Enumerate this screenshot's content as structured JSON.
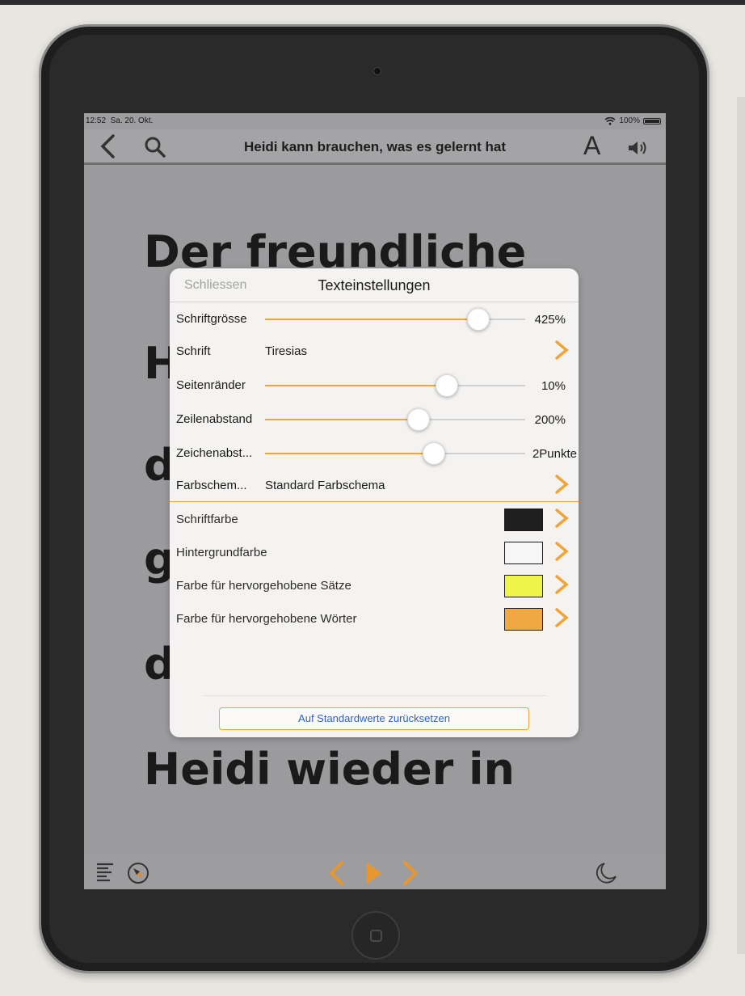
{
  "status_bar": {
    "time": "12:52",
    "date": "Sa. 20. Okt.",
    "battery": "100%"
  },
  "nav": {
    "back_icon": "chevron-left-icon",
    "search_icon": "search-icon",
    "title": "Heidi kann brauchen, was es gelernt hat",
    "font_label": "A",
    "speaker_icon": "speaker-icon"
  },
  "book": {
    "lines": [
      "Der freundliche",
      "H",
      "d",
      "g",
      "d",
      "Heidi wieder in"
    ]
  },
  "settings": {
    "close_label": "Schliessen",
    "title": "Texteinstellungen",
    "font_size": {
      "label": "Schriftgrösse",
      "value_text": "425%",
      "fraction": 0.82
    },
    "font": {
      "label": "Schrift",
      "value": "Tiresias"
    },
    "margins": {
      "label": "Seitenränder",
      "value_text": "10%",
      "fraction": 0.7
    },
    "line_spacing": {
      "label": "Zeilenabstand",
      "value_text": "200%",
      "fraction": 0.59
    },
    "char_spacing": {
      "label": "Zeichenabst...",
      "value_text": "2Punkte",
      "fraction": 0.65
    },
    "color_scheme": {
      "label": "Farbschem...",
      "value": "Standard Farbschema"
    },
    "colors": [
      {
        "label": "Schriftfarbe",
        "color": "#1f1f1f"
      },
      {
        "label": "Hintergrundfarbe",
        "color": "#f6f6f6"
      },
      {
        "label": "Farbe für hervorgehobene Sätze",
        "color": "#eef548"
      },
      {
        "label": "Farbe für hervorgehobene Wörter",
        "color": "#f0a843"
      }
    ],
    "reset_label": "Auf Standardwerte zurücksetzen"
  },
  "toolbar": {
    "contents_icon": "list-icon",
    "compass_icon": "compass-icon",
    "prev_icon": "chevron-left-icon",
    "play_icon": "play-icon",
    "next_icon": "chevron-right-icon",
    "night_icon": "moon-icon"
  },
  "accent_color": "#f0a43a"
}
